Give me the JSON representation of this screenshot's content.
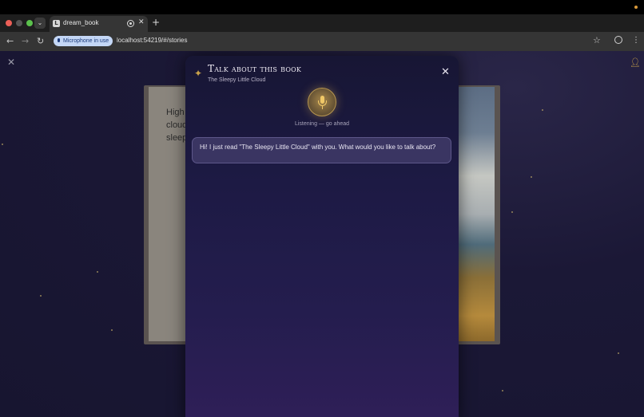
{
  "browser": {
    "tab_title": "dream_book",
    "favicon_letter": "L",
    "mic_indicator": "Microphone in use",
    "url": "localhost:54219/#/stories"
  },
  "book": {
    "left_page_lines": [
      "High",
      "cloud",
      "sleep"
    ]
  },
  "modal": {
    "title": "Talk about this book",
    "subtitle": "The Sleepy Little Cloud",
    "status": "Listening — go ahead",
    "messages": [
      {
        "role": "assistant",
        "text": "Hi! I just read \"The Sleepy Little Cloud\" with you. What would you like to talk about?"
      }
    ]
  },
  "colors": {
    "accent_gold": "#c9a24a",
    "modal_bg": "#1d1a44",
    "bubble_bg": "#3a3562"
  },
  "icons": {
    "modal_header": "sparkle-icon",
    "mic": "microphone-icon",
    "close": "close-icon"
  }
}
